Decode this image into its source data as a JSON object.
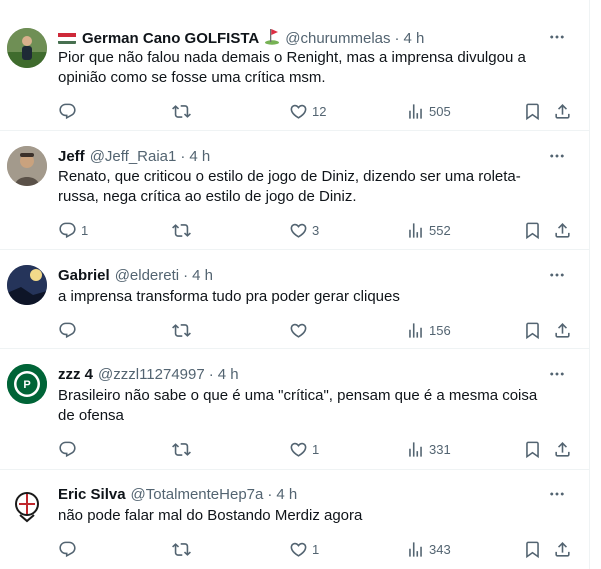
{
  "tweets": [
    {
      "display_name": "German Cano GOLFISTA",
      "handle": "@churummelas",
      "separator": "·",
      "time": "4 h",
      "text": "Pior que não falou nada demais o Renight, mas a imprensa divulgou a opinião como se fosse uma crítica msm.",
      "replies": "",
      "retweets": "",
      "likes": "12",
      "views": "505",
      "avatar_icon": "golfer-photo-avatar",
      "flag_icon": "hungary-flag-icon",
      "emoji_icon": "golf-flag-icon"
    },
    {
      "display_name": "Jeff",
      "handle": "@Jeff_Raia1",
      "separator": "·",
      "time": "4 h",
      "text": "Renato, que criticou o estilo de jogo de Diniz, dizendo ser uma roleta-\nrussa, nega crítica ao estilo de jogo de Diniz.",
      "replies": "1",
      "retweets": "",
      "likes": "3",
      "views": "552",
      "avatar_icon": "person-photo-avatar"
    },
    {
      "display_name": "Gabriel",
      "handle": "@eldereti",
      "separator": "·",
      "time": "4 h",
      "text": "a imprensa transforma tudo pra poder gerar cliques",
      "replies": "",
      "retweets": "",
      "likes": "",
      "views": "156",
      "avatar_icon": "night-photo-avatar"
    },
    {
      "display_name": "zzz 4",
      "handle": "@zzzl11274997",
      "separator": "·",
      "time": "4 h",
      "text": "Brasileiro não sabe o que é uma \"crítica\", pensam que é a mesma coisa de ofensa",
      "replies": "",
      "retweets": "",
      "likes": "1",
      "views": "331",
      "avatar_icon": "palmeiras-crest-avatar"
    },
    {
      "display_name": "Eric Silva",
      "handle": "@TotalmenteHep7a",
      "separator": "·",
      "time": "4 h",
      "text": "não pode falar mal do Bostando Merdiz agora",
      "replies": "",
      "retweets": "",
      "likes": "1",
      "views": "343",
      "avatar_icon": "corinthians-crest-avatar"
    }
  ],
  "colors": {
    "text_primary": "#0f1419",
    "text_secondary": "#536471",
    "divider": "#eff3f4",
    "palmeiras_green": "#006437"
  }
}
